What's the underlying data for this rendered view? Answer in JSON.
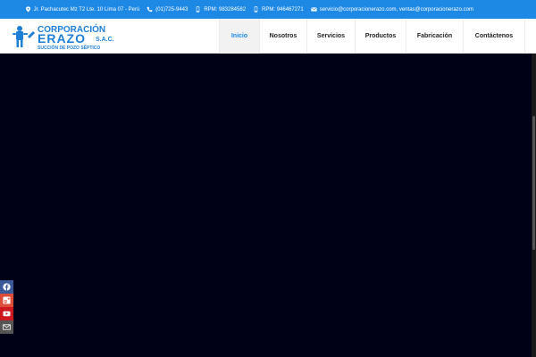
{
  "topbar": {
    "address": "Jr. Pachacutec Mz T2 Lte. 10 Lima 07 - Perú",
    "phone": "(01)725-9443",
    "rpm1": "RPM: 983284582",
    "rpm2": "RPM: 946467271",
    "email": "servicio@corporacionerazo.com, ventas@corporacionerazo.com"
  },
  "logo": {
    "line1": "CORPORACIÓN",
    "line2": "ERAZO",
    "suffix": "S.A.C.",
    "tagline": "SUCCIÓN DE POZO SÉPTICO"
  },
  "nav": {
    "items": [
      {
        "label": "Inicio",
        "active": true
      },
      {
        "label": "Nosotros",
        "active": false
      },
      {
        "label": "Servicios",
        "active": false
      },
      {
        "label": "Productos",
        "active": false
      },
      {
        "label": "Fabricación",
        "active": false
      },
      {
        "label": "Contáctenos",
        "active": false
      }
    ]
  },
  "social": [
    "facebook-icon",
    "google-plus-icon",
    "youtube-icon",
    "mail-icon"
  ],
  "colors": {
    "accent": "#1e88e5",
    "hero": "#000016",
    "logo": "#1e7fd6"
  }
}
